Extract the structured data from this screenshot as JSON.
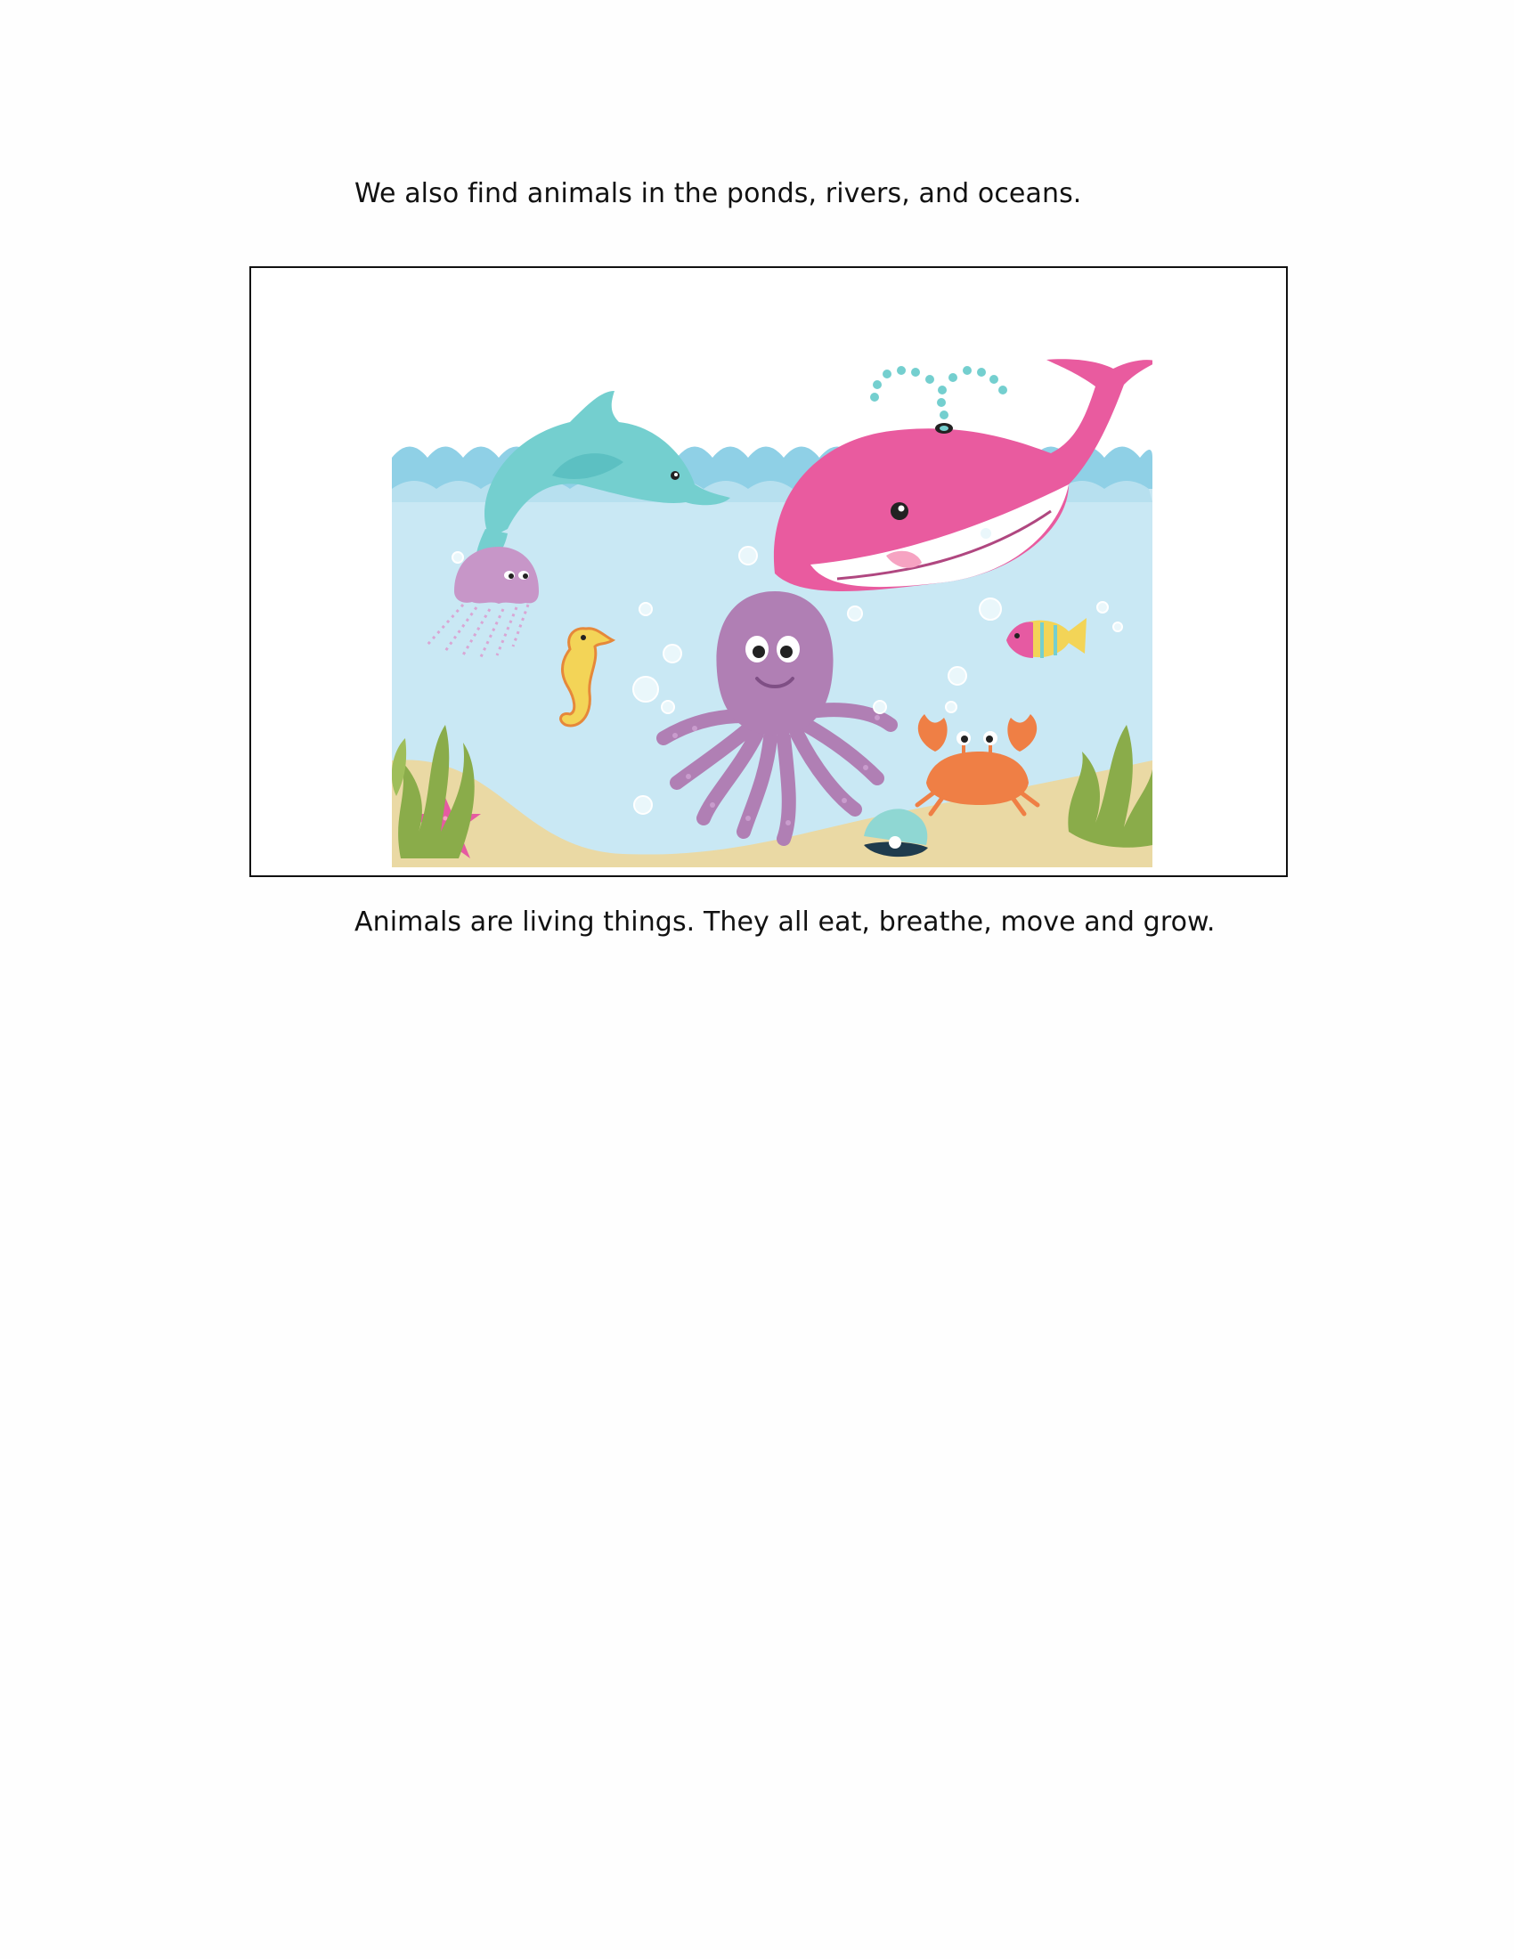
{
  "paragraphs": {
    "intro": "We also find animals in the ponds, rivers, and oceans.",
    "outro": "Animals are living things. They all eat, breathe, move and grow."
  },
  "illustration": {
    "subjects": [
      "dolphin",
      "whale",
      "jellyfish",
      "seahorse",
      "octopus",
      "tropical-fish",
      "crab",
      "starfish",
      "clam-with-pearl",
      "seaweed"
    ],
    "colors": {
      "water": "#c9e8f4",
      "waves": "#8fd0e6",
      "sand": "#ead9a4",
      "dolphin": "#74cfcf",
      "whale": "#e95b9f",
      "octopus": "#b07fb4",
      "jellyfish": "#c796c8",
      "crab": "#ef7f45",
      "seahorse": "#f3d457",
      "starfish": "#e65aa2",
      "seaweed": "#8aac4a"
    }
  }
}
